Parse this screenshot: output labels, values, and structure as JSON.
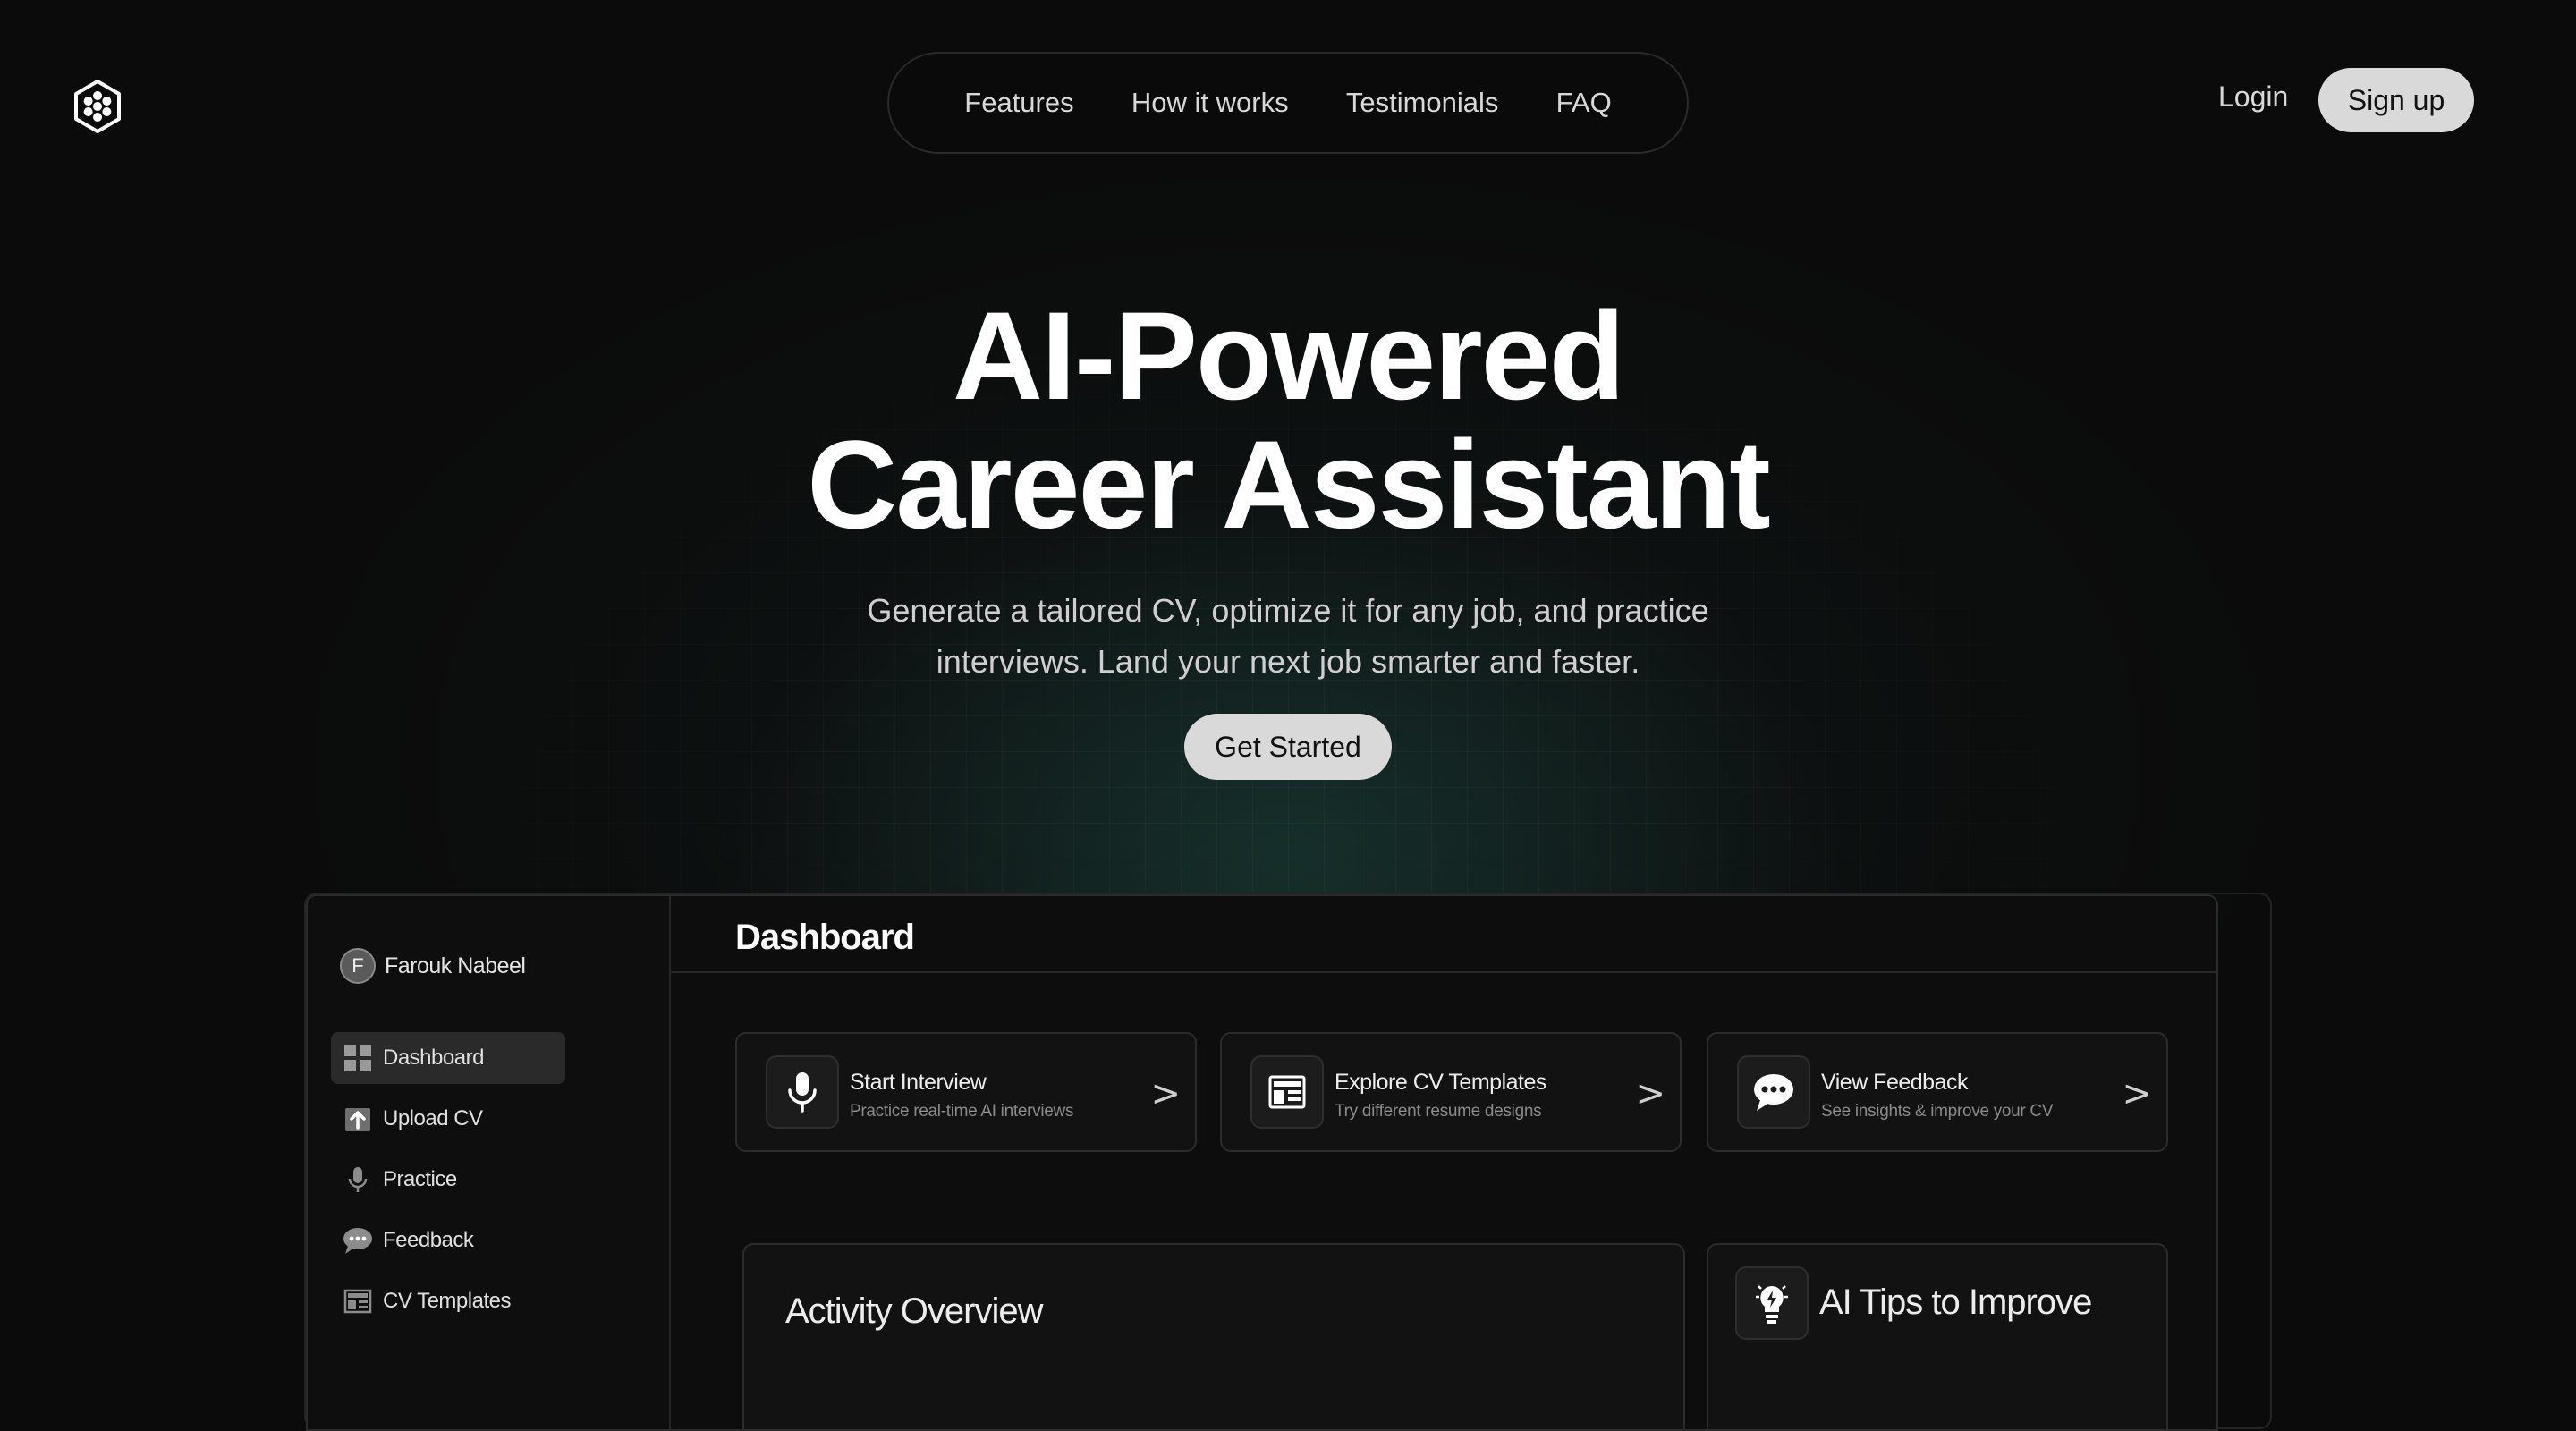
{
  "header": {
    "logo_icon": "hexagon-flower-logo",
    "nav": [
      {
        "label": "Features"
      },
      {
        "label": "How it works"
      },
      {
        "label": "Testimonials"
      },
      {
        "label": "FAQ"
      }
    ],
    "login_label": "Login",
    "signup_label": "Sign up"
  },
  "hero": {
    "title_line1": "AI-Powered",
    "title_line2": "Career Assistant",
    "subtitle_line1": "Generate a tailored CV, optimize it for any job, and practice",
    "subtitle_line2": "interviews. Land your next job smarter and faster.",
    "cta_label": "Get Started"
  },
  "dashboard": {
    "user": {
      "initial": "F",
      "name": "Farouk Nabeel"
    },
    "sidebar": [
      {
        "label": "Dashboard",
        "icon": "grid-icon",
        "active": true
      },
      {
        "label": "Upload CV",
        "icon": "upload-icon"
      },
      {
        "label": "Practice",
        "icon": "microphone-icon"
      },
      {
        "label": "Feedback",
        "icon": "speech-bubble-icon"
      },
      {
        "label": "CV Templates",
        "icon": "template-icon"
      }
    ],
    "title": "Dashboard",
    "actions": [
      {
        "title": "Start Interview",
        "desc": "Practice real-time AI interviews",
        "icon": "microphone-icon"
      },
      {
        "title": "Explore CV Templates",
        "desc": "Try different resume designs",
        "icon": "template-icon"
      },
      {
        "title": "View Feedback",
        "desc": "See insights & improve your CV",
        "icon": "speech-bubble-icon"
      }
    ],
    "chevron": ">",
    "activity_title": "Activity Overview",
    "tips_title": "AI Tips to Improve",
    "tips_icon": "lightbulb-icon"
  },
  "colors": {
    "background": "#0b0b0b",
    "button_bg": "#d9d9d9",
    "accent_glow": "#235a52"
  }
}
